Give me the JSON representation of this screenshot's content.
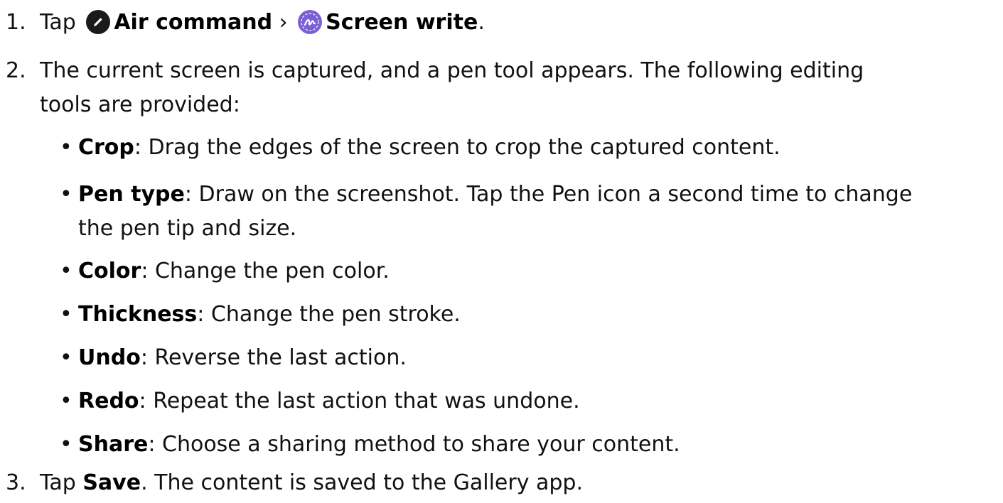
{
  "steps": [
    {
      "num": "1.",
      "prefix": "Tap ",
      "air_command": "Air command",
      "separator": " › ",
      "screen_write": "Screen write",
      "suffix": "."
    },
    {
      "num": "2.",
      "line1": "The current screen is captured, and a pen tool appears. The following editing",
      "line2": "tools are provided:"
    },
    {
      "num": "3.",
      "prefix": "Tap ",
      "save": "Save",
      "suffix": ". The content is saved to the Gallery app."
    }
  ],
  "bullet_glyph": "•",
  "tools": [
    {
      "term": "Crop",
      "desc": ": Drag the edges of the screen to crop the captured content."
    },
    {
      "term": "Pen type",
      "desc": ": Draw on the screenshot. Tap the Pen icon a second time to change",
      "desc2": "the pen tip and size."
    },
    {
      "term": "Color",
      "desc": ": Change the pen color."
    },
    {
      "term": "Thickness",
      "desc": ": Change the pen stroke."
    },
    {
      "term": "Undo",
      "desc": ": Reverse the last action."
    },
    {
      "term": "Redo",
      "desc": ": Repeat the last action that was undone."
    },
    {
      "term": "Share",
      "desc": ": Choose a sharing method to share your content."
    }
  ],
  "colors": {
    "air_command_icon": "#1a1a1a",
    "screen_write_icon": "#7b5fd6"
  }
}
